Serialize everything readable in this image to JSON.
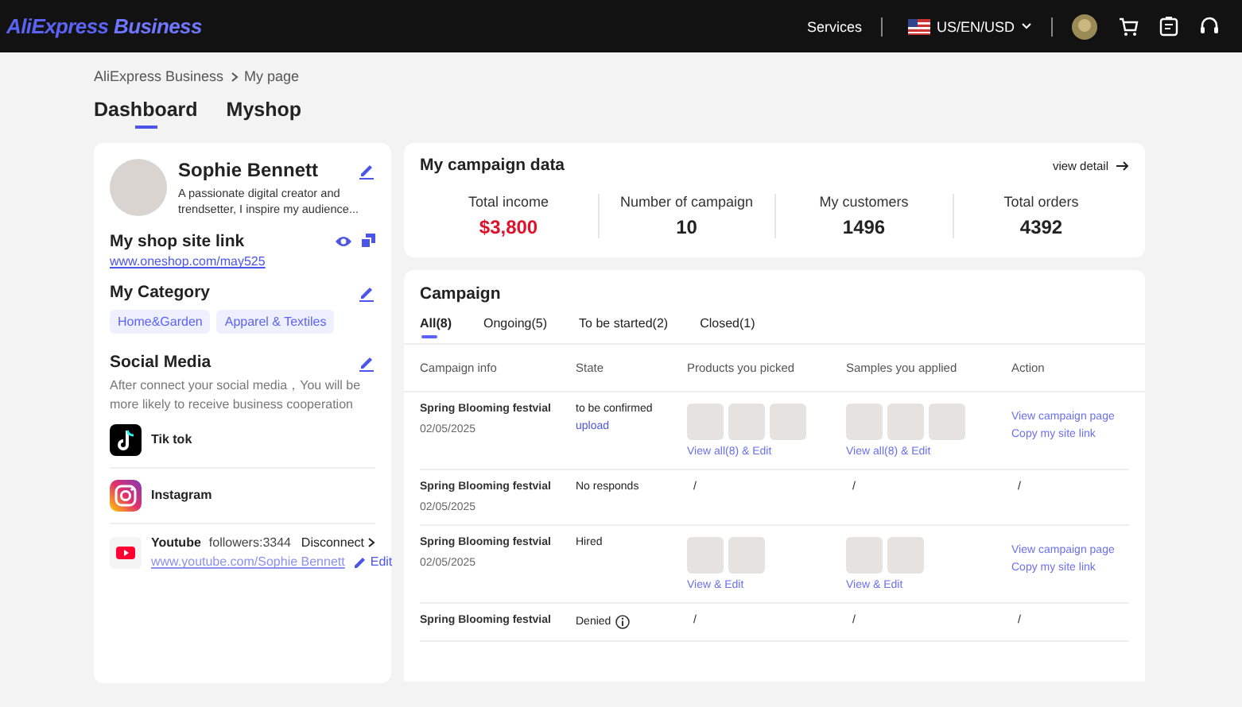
{
  "header": {
    "logo": {
      "brand": "AliExpress",
      "product": "Business"
    },
    "services": "Services",
    "locale": "US/EN/USD"
  },
  "breadcrumb": [
    "AliExpress Business",
    "My page"
  ],
  "tabs": [
    {
      "label": "Dashboard",
      "selected": true
    },
    {
      "label": "Myshop",
      "selected": false
    }
  ],
  "profile": {
    "name": "Sophie Bennett",
    "bio": "A passionate digital creator and trendsetter, I inspire my audience...",
    "shop_link_title": "My shop site link",
    "shop_link": "www.oneshop.com/may525",
    "category_title": "My Category",
    "categories": [
      "Home&Garden",
      "Apparel & Textiles"
    ],
    "social_title": "Social Media",
    "social_hint": "After connect your social media，You will be more likely to receive business cooperation",
    "socials": [
      {
        "name": "Tik tok",
        "connected": false
      },
      {
        "name": "Instagram",
        "connected": false
      },
      {
        "name": "Youtube",
        "connected": true,
        "followers": "followers:3344",
        "action": "Disconnect",
        "url": "www.youtube.com/Sophie Bennett",
        "edit": "Edit"
      }
    ]
  },
  "campaign_data": {
    "title": "My campaign data",
    "detail_link": "view detail",
    "stats": [
      {
        "label": "Total income",
        "value": "$3,800",
        "highlight": true
      },
      {
        "label": "Number of campaign",
        "value": "10",
        "highlight": false
      },
      {
        "label": "My customers",
        "value": "1496",
        "highlight": false
      },
      {
        "label": "Total orders",
        "value": "4392",
        "highlight": false
      }
    ]
  },
  "campaign": {
    "title": "Campaign",
    "filters": [
      {
        "label": "All(8)",
        "selected": true
      },
      {
        "label": "Ongoing(5)",
        "selected": false
      },
      {
        "label": "To be started(2)",
        "selected": false
      },
      {
        "label": "Closed(1)",
        "selected": false
      }
    ],
    "columns": [
      "Campaign info",
      "State",
      "Products you picked",
      "Samples you applied",
      "Action"
    ],
    "rows": [
      {
        "name": "Spring Blooming festvial",
        "date": "02/05/2025",
        "state": "to be confirmed",
        "state_link": "upload",
        "info_icon": false,
        "products": {
          "kind": "gallery",
          "photos": [
            {
              "kind": "photo"
            },
            {
              "kind": "photo"
            },
            {
              "kind": "photo"
            }
          ],
          "link": "View all(8) & Edit"
        },
        "samples": {
          "kind": "gallery",
          "photos": [
            {
              "kind": "photo"
            },
            {
              "kind": "photo"
            },
            {
              "kind": "photo"
            }
          ],
          "link": "View all(8) & Edit"
        },
        "actions": {
          "kind": "links",
          "links": [
            "View campaign page",
            "Copy my site link"
          ]
        }
      },
      {
        "name": "Spring Blooming festvial",
        "date": "02/05/2025",
        "state": "No responds",
        "info_icon": false,
        "products": {
          "kind": "empty",
          "text": "/"
        },
        "samples": {
          "kind": "empty",
          "text": "/"
        },
        "actions": {
          "kind": "empty",
          "text": "/"
        }
      },
      {
        "name": "Spring Blooming festvial",
        "date": "02/05/2025",
        "state": "Hired",
        "info_icon": false,
        "products": {
          "kind": "gallery",
          "photos": [
            {
              "kind": "photo"
            },
            {
              "kind": "photo"
            }
          ],
          "link": "View & Edit"
        },
        "samples": {
          "kind": "gallery",
          "photos": [
            {
              "kind": "photo"
            },
            {
              "kind": "photo"
            }
          ],
          "link": "View & Edit"
        },
        "actions": {
          "kind": "links",
          "links": [
            "View campaign page",
            "Copy my site link"
          ]
        }
      },
      {
        "name": "Spring Blooming festvial",
        "state": "Denied",
        "info_icon": true,
        "products": {
          "kind": "empty",
          "text": "/"
        },
        "samples": {
          "kind": "empty",
          "text": "/"
        },
        "actions": {
          "kind": "empty",
          "text": "/"
        }
      }
    ]
  }
}
